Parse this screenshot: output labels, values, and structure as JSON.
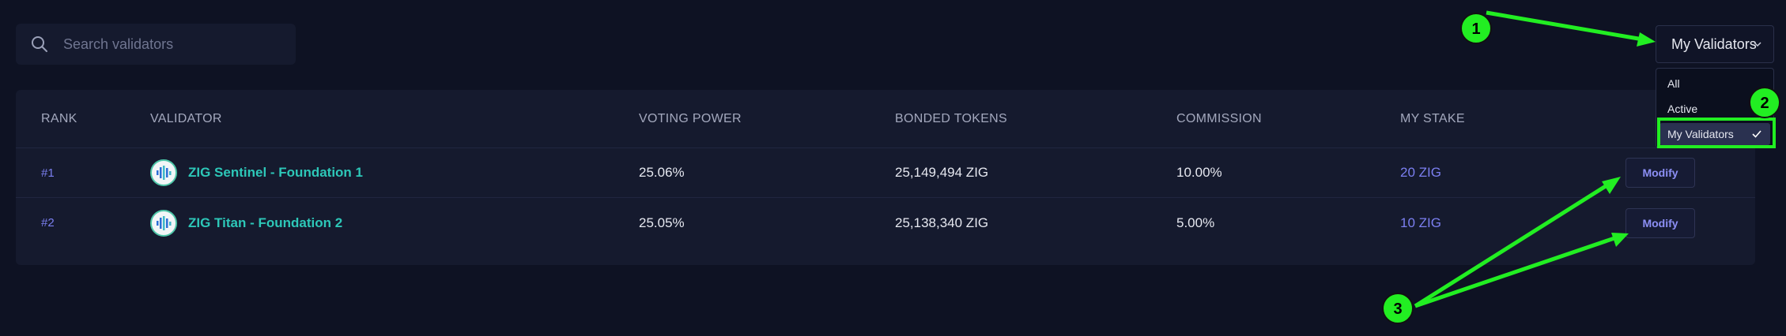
{
  "search": {
    "placeholder": "Search validators"
  },
  "filter": {
    "selected": "My Validators",
    "options": [
      "All",
      "Active",
      "My Validators"
    ]
  },
  "table": {
    "headers": [
      "RANK",
      "VALIDATOR",
      "VOTING POWER",
      "BONDED TOKENS",
      "COMMISSION",
      "MY STAKE"
    ],
    "rows": [
      {
        "rank": "#1",
        "validator": "ZIG Sentinel - Foundation 1",
        "voting_power": "25.06%",
        "bonded_tokens": "25,149,494 ZIG",
        "commission": "10.00%",
        "my_stake": "20 ZIG",
        "action": "Modify"
      },
      {
        "rank": "#2",
        "validator": "ZIG Titan - Foundation 2",
        "voting_power": "25.05%",
        "bonded_tokens": "25,138,340 ZIG",
        "commission": "5.00%",
        "my_stake": "10 ZIG",
        "action": "Modify"
      }
    ]
  },
  "annotations": [
    "1",
    "2",
    "3"
  ],
  "colors": {
    "background": "#0e1223",
    "panel": "#151a2e",
    "accent_purple": "#7b7ff0",
    "validator_teal": "#2dc7b8",
    "annotation_green": "#22ee22"
  }
}
